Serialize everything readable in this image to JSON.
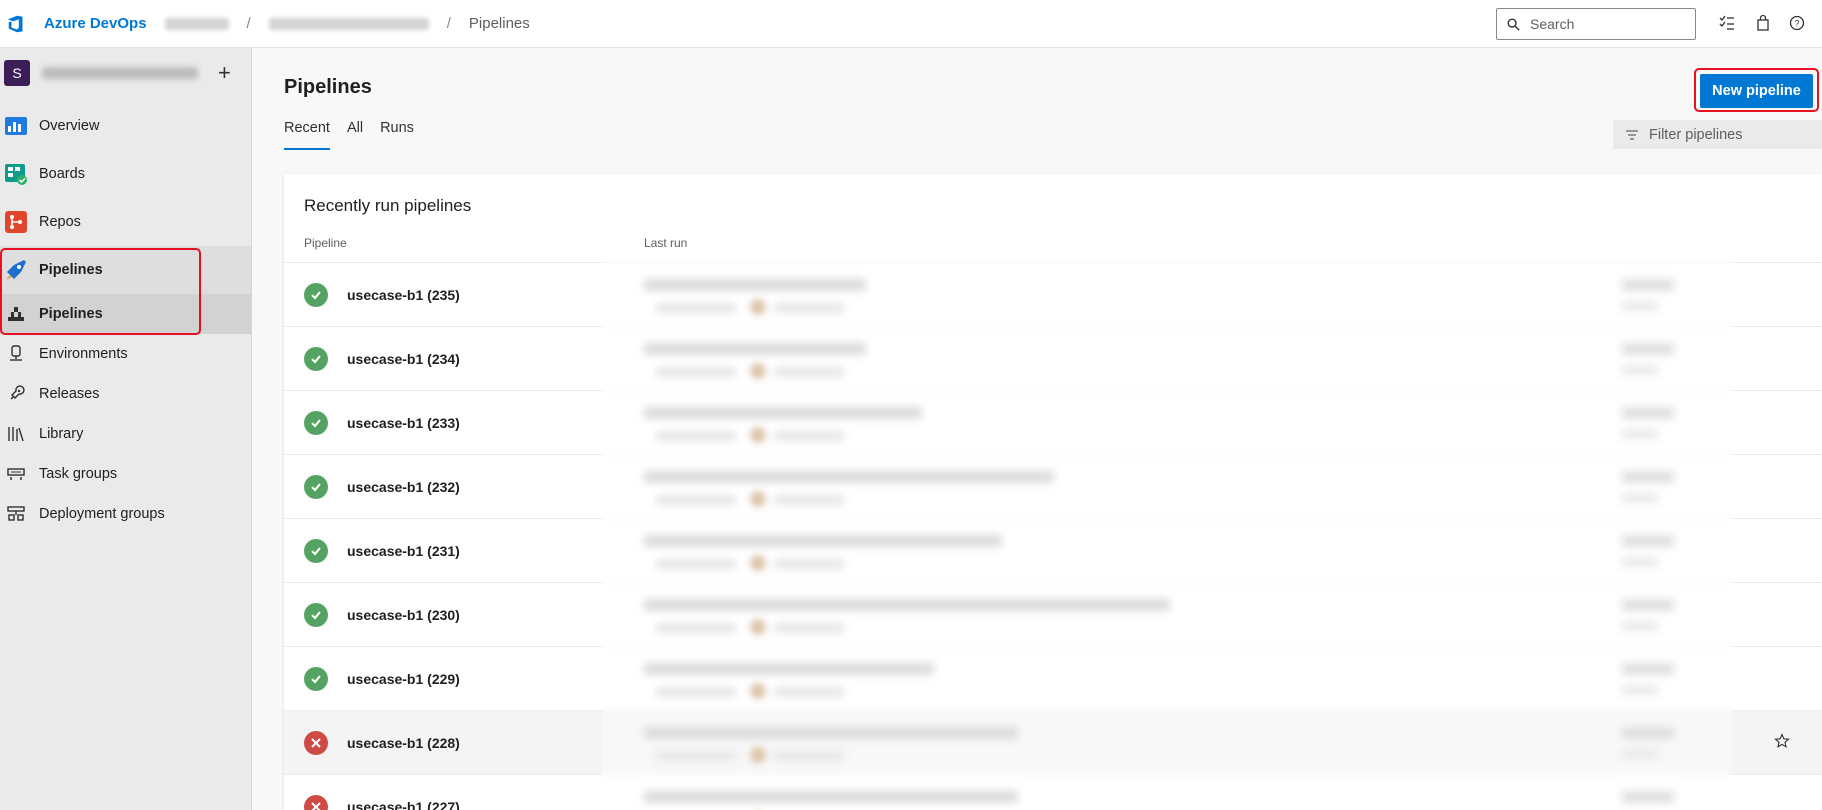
{
  "topbar": {
    "brand": "Azure DevOps",
    "breadcrumb_sep": "/",
    "breadcrumb_current": "Pipelines",
    "search_placeholder": "Search"
  },
  "sidebar": {
    "project_initial": "S",
    "items": [
      {
        "label": "Overview",
        "icon": "overview-icon"
      },
      {
        "label": "Boards",
        "icon": "boards-icon"
      },
      {
        "label": "Repos",
        "icon": "repos-icon"
      },
      {
        "label": "Pipelines",
        "icon": "pipelines-icon"
      },
      {
        "label": "Pipelines",
        "icon": "pipelines-sub-icon"
      },
      {
        "label": "Environments",
        "icon": "environments-icon"
      },
      {
        "label": "Releases",
        "icon": "releases-icon"
      },
      {
        "label": "Library",
        "icon": "library-icon"
      },
      {
        "label": "Task groups",
        "icon": "task-groups-icon"
      },
      {
        "label": "Deployment groups",
        "icon": "deployment-groups-icon"
      }
    ]
  },
  "main": {
    "title": "Pipelines",
    "new_button": "New pipeline",
    "tabs": [
      "Recent",
      "All",
      "Runs"
    ],
    "filter_placeholder": "Filter pipelines",
    "card_title": "Recently run pipelines",
    "col_pipeline": "Pipeline",
    "col_last_run": "Last run",
    "rows": [
      {
        "name": "usecase-b1 (235)",
        "status": "succeeded"
      },
      {
        "name": "usecase-b1 (234)",
        "status": "succeeded"
      },
      {
        "name": "usecase-b1 (233)",
        "status": "succeeded"
      },
      {
        "name": "usecase-b1 (232)",
        "status": "succeeded"
      },
      {
        "name": "usecase-b1 (231)",
        "status": "succeeded"
      },
      {
        "name": "usecase-b1 (230)",
        "status": "succeeded"
      },
      {
        "name": "usecase-b1 (229)",
        "status": "succeeded"
      },
      {
        "name": "usecase-b1 (228)",
        "status": "failed"
      },
      {
        "name": "usecase-b1 (227)",
        "status": "failed"
      }
    ]
  },
  "colors": {
    "accent": "#0078d4",
    "success": "#55a362",
    "failure": "#cd4a45",
    "highlight_border": "#e81123"
  }
}
